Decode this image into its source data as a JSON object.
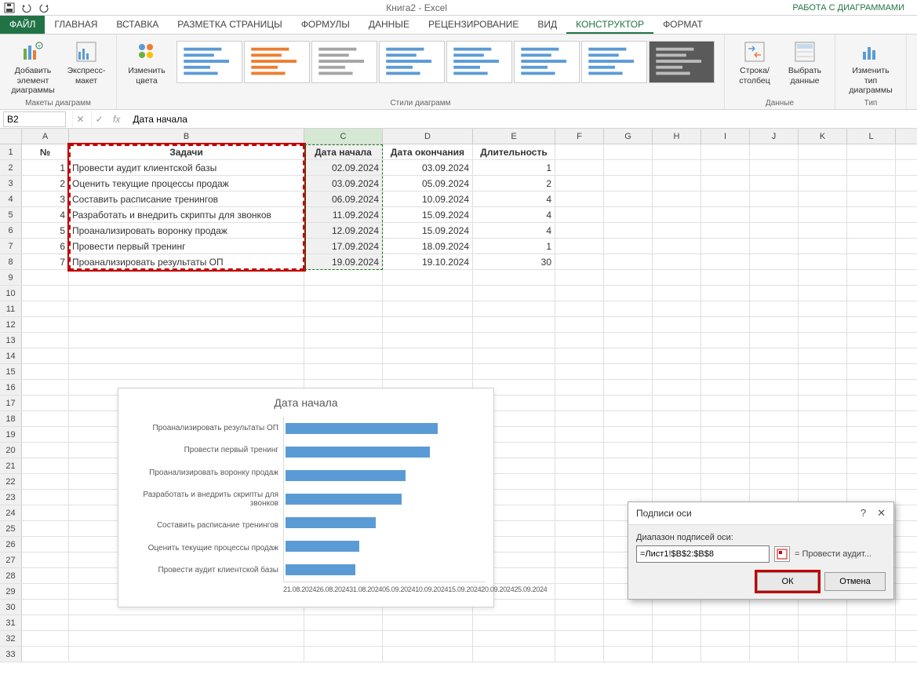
{
  "app": {
    "title": "Книга2 - Excel",
    "chart_tools": "РАБОТА С ДИАГРАММАМИ"
  },
  "tabs": {
    "file": "ФАЙЛ",
    "home": "ГЛАВНАЯ",
    "insert": "ВСТАВКА",
    "layout": "РАЗМЕТКА СТРАНИЦЫ",
    "formulas": "ФОРМУЛЫ",
    "data": "ДАННЫЕ",
    "review": "РЕЦЕНЗИРОВАНИЕ",
    "view": "ВИД",
    "design": "КОНСТРУКТОР",
    "format": "ФОРМАТ"
  },
  "ribbon": {
    "add_element": "Добавить элемент диаграммы",
    "express": "Экспресс-макет",
    "change_colors": "Изменить цвета",
    "row_col": "Строка/столбец",
    "select_data": "Выбрать данные",
    "change_type": "Изменить тип диаграммы",
    "layouts_group": "Макеты диаграмм",
    "styles_group": "Стили диаграмм",
    "data_group": "Данные",
    "type_group": "Тип"
  },
  "namebox": "B2",
  "formula": "Дата начала",
  "headers": {
    "A": "№",
    "B": "Задачи",
    "C": "Дата начала",
    "D": "Дата окончания",
    "E": "Длительность"
  },
  "rows": [
    {
      "n": "1",
      "task": "Провести аудит клиентской базы",
      "start": "02.09.2024",
      "end": "03.09.2024",
      "dur": "1"
    },
    {
      "n": "2",
      "task": "Оценить текущие процессы продаж",
      "start": "03.09.2024",
      "end": "05.09.2024",
      "dur": "2"
    },
    {
      "n": "3",
      "task": "Составить расписание тренингов",
      "start": "06.09.2024",
      "end": "10.09.2024",
      "dur": "4"
    },
    {
      "n": "4",
      "task": "Разработать и внедрить скрипты для звонков",
      "start": "11.09.2024",
      "end": "15.09.2024",
      "dur": "4"
    },
    {
      "n": "5",
      "task": "Проанализировать воронку продаж",
      "start": "12.09.2024",
      "end": "15.09.2024",
      "dur": "4"
    },
    {
      "n": "6",
      "task": "Провести первый тренинг",
      "start": "17.09.2024",
      "end": "18.09.2024",
      "dur": "1"
    },
    {
      "n": "7",
      "task": "Проанализировать результаты ОП",
      "start": "19.09.2024",
      "end": "19.10.2024",
      "dur": "30"
    }
  ],
  "chart_data": {
    "type": "bar",
    "title": "Дата начала",
    "categories": [
      "Проанализировать результаты ОП",
      "Провести первый тренинг",
      "Проанализировать воронку продаж",
      "Разработать и внедрить скрипты для звонков",
      "Составить расписание тренингов",
      "Оценить текущие процессы продаж",
      "Провести аудит клиентской базы"
    ],
    "values_display": [
      "19.09.2024",
      "17.09.2024",
      "12.09.2024",
      "11.09.2024",
      "06.09.2024",
      "03.09.2024",
      "02.09.2024"
    ],
    "bar_pct": [
      76,
      72,
      60,
      58,
      45,
      37,
      35
    ],
    "xticks": [
      "21.08.2024",
      "26.08.2024",
      "31.08.2024",
      "05.09.2024",
      "10.09.2024",
      "15.09.2024",
      "20.09.2024",
      "25.09.2024"
    ]
  },
  "dialog": {
    "title": "Подписи оси",
    "label": "Диапазон подписей оси:",
    "input": "=Лист1!$B$2:$B$8",
    "preview": "= Провести аудит...",
    "ok": "ОК",
    "cancel": "Отмена"
  }
}
